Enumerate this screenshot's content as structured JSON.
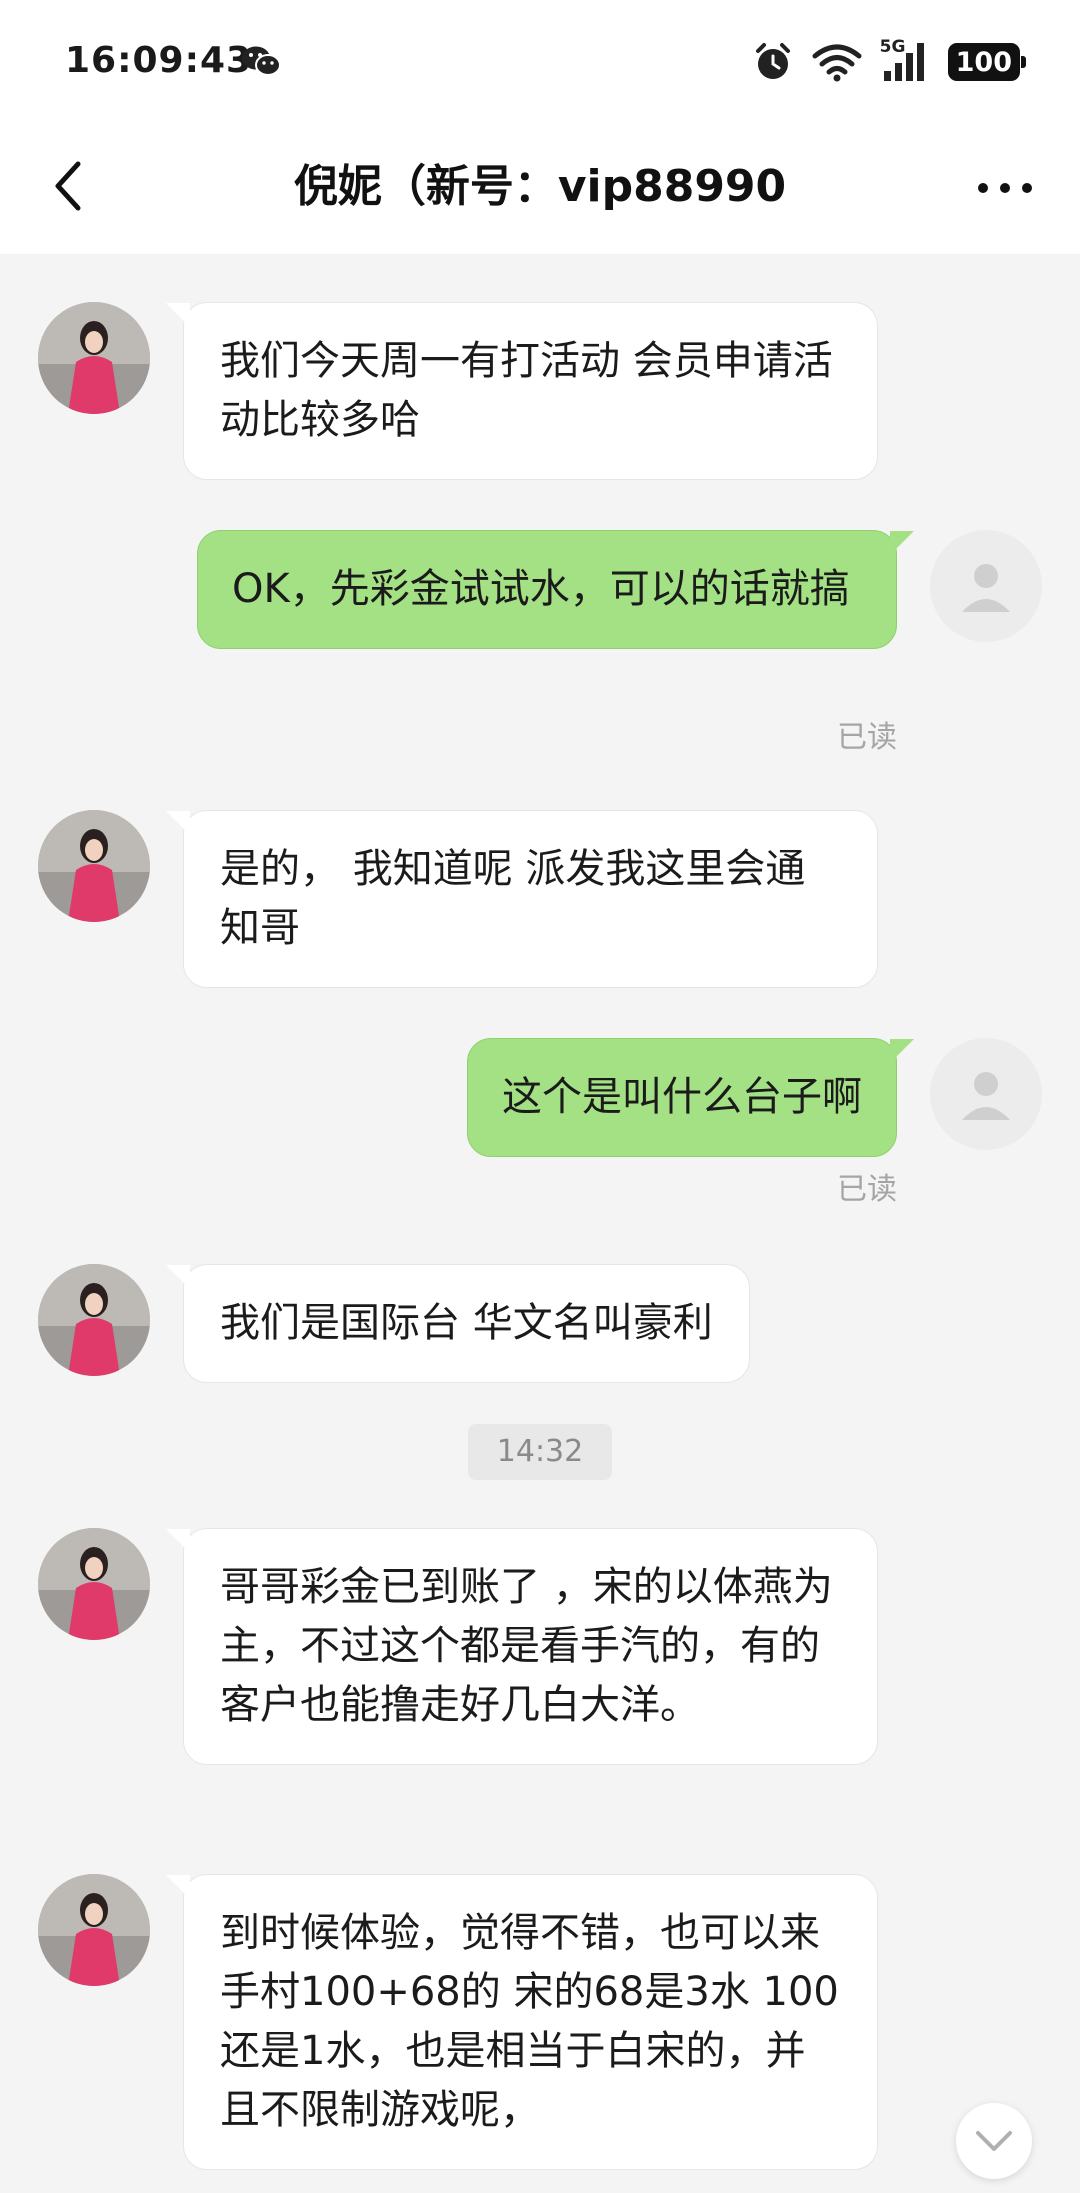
{
  "status_bar": {
    "time": "16:09:43",
    "network": "5G",
    "battery": "100",
    "icons": [
      "wechat-icon",
      "alarm-icon",
      "wifi-icon",
      "signal-icon",
      "battery-icon"
    ]
  },
  "header": {
    "title": "倪妮（新号：vip88990",
    "back_icon": "chevron-left-icon",
    "more_icon": "more-dots-icon"
  },
  "messages": [
    {
      "side": "in",
      "text": "我们今天周一有打活动 会员申请活动比较多哈"
    },
    {
      "side": "out",
      "text": "OK，先彩金试试水，可以的话就搞",
      "status": "已读"
    },
    {
      "side": "in",
      "text": "是的， 我知道呢  派发我这里会通知哥"
    },
    {
      "side": "out",
      "text": "这个是叫什么台子啊",
      "status": "已读"
    },
    {
      "side": "in",
      "text": "我们是国际台 华文名叫豪利"
    },
    {
      "side": "timestamp",
      "text": "14:32"
    },
    {
      "side": "in",
      "text": "哥哥彩金已到账了 ，宋的以体燕为主，不过这个都是看手汽的，有的客户也能撸走好几白大洋。"
    },
    {
      "side": "in",
      "text": "到时候体验，觉得不错，也可以来手村100+68的 宋的68是3水 100还是1水，也是相当于白宋的，并且不限制游戏呢，"
    }
  ],
  "colors": {
    "outgoing_bubble": "#a3e184",
    "incoming_bubble": "#ffffff",
    "chat_background": "#f4f4f4"
  }
}
